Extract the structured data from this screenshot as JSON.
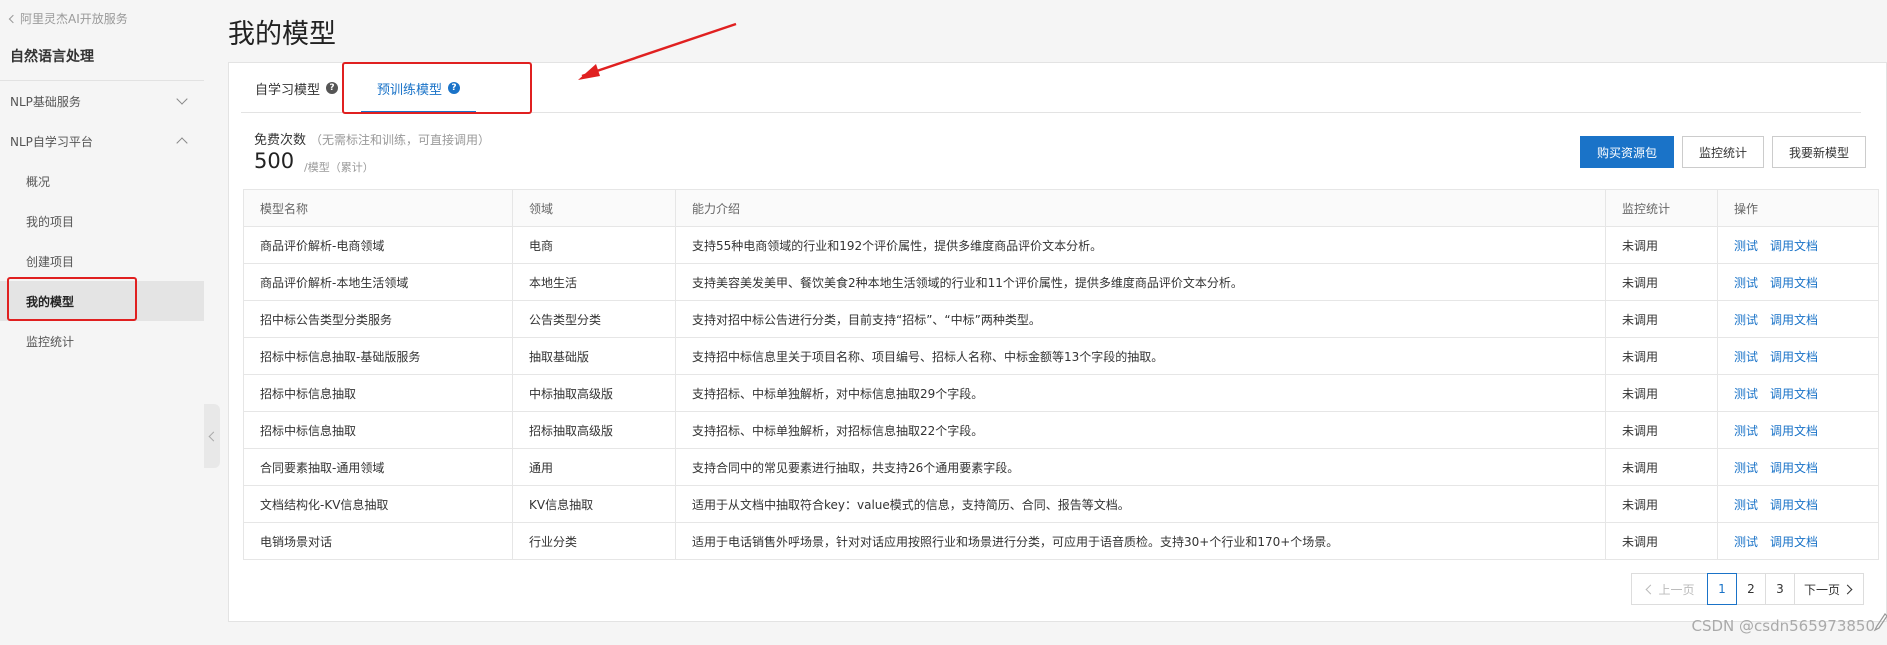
{
  "sidebar": {
    "back_label": "阿里灵杰AI开放服务",
    "title": "自然语言处理",
    "groups": [
      {
        "label": "NLP基础服务",
        "expanded": false
      },
      {
        "label": "NLP自学习平台",
        "expanded": true
      }
    ],
    "items": [
      {
        "label": "概况"
      },
      {
        "label": "我的项目"
      },
      {
        "label": "创建项目"
      },
      {
        "label": "我的模型",
        "active": true
      },
      {
        "label": "监控统计"
      }
    ]
  },
  "page": {
    "title": "我的模型"
  },
  "tabs": [
    {
      "label": "自学习模型",
      "active": false
    },
    {
      "label": "预训练模型",
      "active": true
    }
  ],
  "quota": {
    "label": "免费次数",
    "note": "（无需标注和训练，可直接调用）",
    "value": "500",
    "unit": "/模型（累计）"
  },
  "buttons": {
    "buy": "购买资源包",
    "monitor": "监控统计",
    "new_model": "我要新模型"
  },
  "table": {
    "headers": [
      "模型名称",
      "领域",
      "能力介绍",
      "监控统计",
      "操作"
    ],
    "rows": [
      {
        "name": "商品评价解析-电商领域",
        "domain": "电商",
        "desc": "支持55种电商领域的行业和192个评价属性，提供多维度商品评价文本分析。",
        "stat": "未调用",
        "op1": "测试",
        "op2": "调用文档"
      },
      {
        "name": "商品评价解析-本地生活领域",
        "domain": "本地生活",
        "desc": "支持美容美发美甲、餐饮美食2种本地生活领域的行业和11个评价属性，提供多维度商品评价文本分析。",
        "stat": "未调用",
        "op1": "测试",
        "op2": "调用文档"
      },
      {
        "name": "招中标公告类型分类服务",
        "domain": "公告类型分类",
        "desc": "支持对招中标公告进行分类，目前支持“招标”、“中标”两种类型。",
        "stat": "未调用",
        "op1": "测试",
        "op2": "调用文档"
      },
      {
        "name": "招标中标信息抽取-基础版服务",
        "domain": "抽取基础版",
        "desc": "支持招中标信息里关于项目名称、项目编号、招标人名称、中标金额等13个字段的抽取。",
        "stat": "未调用",
        "op1": "测试",
        "op2": "调用文档"
      },
      {
        "name": "招标中标信息抽取",
        "domain": "中标抽取高级版",
        "desc": "支持招标、中标单独解析，对中标信息抽取29个字段。",
        "stat": "未调用",
        "op1": "测试",
        "op2": "调用文档"
      },
      {
        "name": "招标中标信息抽取",
        "domain": "招标抽取高级版",
        "desc": "支持招标、中标单独解析，对招标信息抽取22个字段。",
        "stat": "未调用",
        "op1": "测试",
        "op2": "调用文档"
      },
      {
        "name": "合同要素抽取-通用领域",
        "domain": "通用",
        "desc": "支持合同中的常见要素进行抽取，共支持26个通用要素字段。",
        "stat": "未调用",
        "op1": "测试",
        "op2": "调用文档"
      },
      {
        "name": "文档结构化-KV信息抽取",
        "domain": "KV信息抽取",
        "desc": "适用于从文档中抽取符合key：value模式的信息，支持简历、合同、报告等文档。",
        "stat": "未调用",
        "op1": "测试",
        "op2": "调用文档"
      },
      {
        "name": "电销场景对话",
        "domain": "行业分类",
        "desc": "适用于电话销售外呼场景，针对对话应用按照行业和场景进行分类，可应用于语音质检。支持30+个行业和170+个场景。",
        "stat": "未调用",
        "op1": "测试",
        "op2": "调用文档"
      }
    ]
  },
  "pagination": {
    "prev": "上一页",
    "pages": [
      "1",
      "2",
      "3"
    ],
    "current": "1",
    "next": "下一页"
  },
  "watermark": "CSDN @csdn565973850",
  "colors": {
    "accent": "#1a73c8",
    "annotation": "#e02020"
  }
}
